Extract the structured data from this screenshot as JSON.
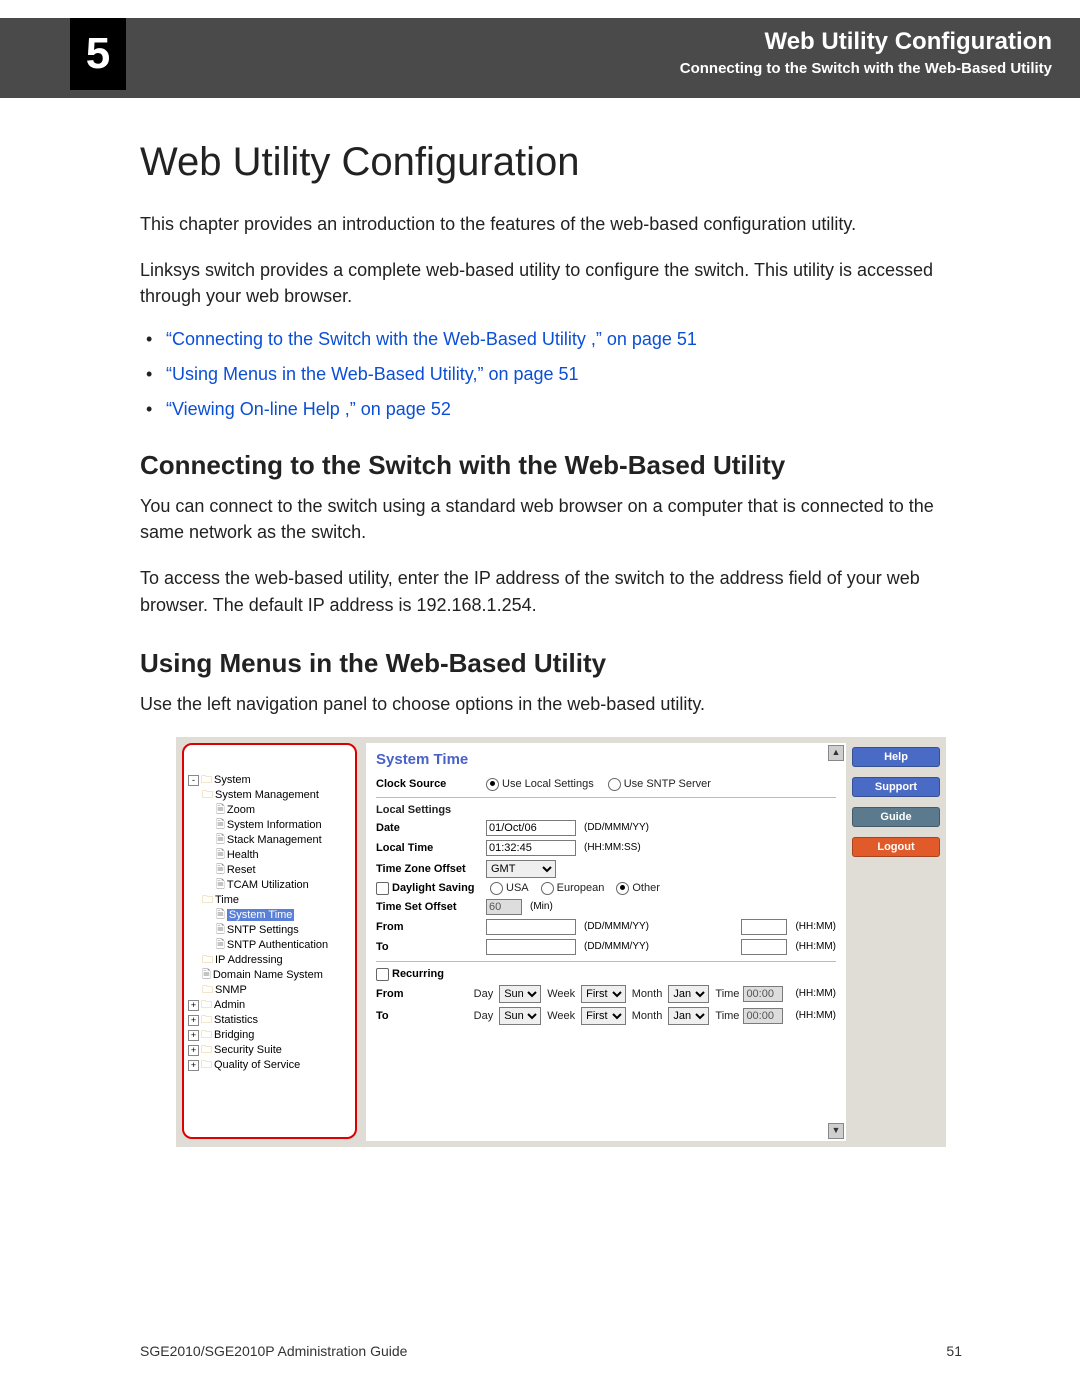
{
  "header": {
    "chapter_number": "5",
    "title": "Web Utility Configuration",
    "subtitle": "Connecting to the Switch with the Web-Based Utility"
  },
  "doc_title": "Web Utility Configuration",
  "intro_p1": "This chapter provides an introduction to the features of the web-based configuration utility.",
  "intro_p2": "Linksys switch provides a complete web-based utility to configure the switch. This utility is accessed through your web browser.",
  "links": [
    "“Connecting to the Switch with the Web-Based Utility ,” on page 51",
    "“Using Menus in the Web-Based Utility,” on page 51",
    "“Viewing On-line Help ,” on page 52"
  ],
  "section1": {
    "heading": "Connecting to the Switch with the Web-Based Utility",
    "p1": "You can connect to the switch using a standard web browser on a computer that is connected to the same network as the switch.",
    "p2": "To access the web-based utility, enter the IP address of the switch to the address field of your web browser. The default IP address is 192.168.1.254."
  },
  "section2": {
    "heading": "Using Menus in the Web-Based Utility",
    "p1": "Use the left navigation panel to choose options in the web-based utility."
  },
  "footer": {
    "left": "SGE2010/SGE2010P Administration Guide",
    "right": "51"
  },
  "screenshot": {
    "panel_title": "System Time",
    "side_buttons": [
      "Help",
      "Support",
      "Guide",
      "Logout"
    ],
    "tree": [
      {
        "depth": 0,
        "exp": "-",
        "icon": "folder",
        "label": "System"
      },
      {
        "depth": 1,
        "exp": "",
        "icon": "folder",
        "label": "System Management"
      },
      {
        "depth": 2,
        "exp": "",
        "icon": "page",
        "label": "Zoom"
      },
      {
        "depth": 2,
        "exp": "",
        "icon": "page",
        "label": "System Information"
      },
      {
        "depth": 2,
        "exp": "",
        "icon": "page",
        "label": "Stack Management"
      },
      {
        "depth": 2,
        "exp": "",
        "icon": "page",
        "label": "Health"
      },
      {
        "depth": 2,
        "exp": "",
        "icon": "page",
        "label": "Reset"
      },
      {
        "depth": 2,
        "exp": "",
        "icon": "page",
        "label": "TCAM Utilization"
      },
      {
        "depth": 1,
        "exp": "",
        "icon": "folder",
        "label": "Time"
      },
      {
        "depth": 2,
        "exp": "",
        "icon": "page",
        "label": "System Time",
        "selected": true
      },
      {
        "depth": 2,
        "exp": "",
        "icon": "page",
        "label": "SNTP Settings"
      },
      {
        "depth": 2,
        "exp": "",
        "icon": "page",
        "label": "SNTP Authentication"
      },
      {
        "depth": 1,
        "exp": "",
        "icon": "folder",
        "label": "IP Addressing"
      },
      {
        "depth": 1,
        "exp": "",
        "icon": "page",
        "label": "Domain Name System"
      },
      {
        "depth": 1,
        "exp": "",
        "icon": "folder",
        "label": "SNMP"
      },
      {
        "depth": 0,
        "exp": "+",
        "icon": "folder",
        "label": "Admin"
      },
      {
        "depth": 0,
        "exp": "+",
        "icon": "folder",
        "label": "Statistics"
      },
      {
        "depth": 0,
        "exp": "+",
        "icon": "folder",
        "label": "Bridging"
      },
      {
        "depth": 0,
        "exp": "+",
        "icon": "folder",
        "label": "Security Suite"
      },
      {
        "depth": 0,
        "exp": "+",
        "icon": "folder",
        "label": "Quality of Service"
      }
    ],
    "form": {
      "clock_source_label": "Clock Source",
      "clock_source_opt1": "Use Local Settings",
      "clock_source_opt2": "Use SNTP Server",
      "local_settings_label": "Local Settings",
      "date_label": "Date",
      "date_value": "01/Oct/06",
      "date_hint": "(DD/MMM/YY)",
      "local_time_label": "Local Time",
      "local_time_value": "01:32:45",
      "local_time_hint": "(HH:MM:SS)",
      "tz_label": "Time Zone Offset",
      "tz_value": "GMT",
      "ds_label": "Daylight Saving",
      "ds_opt1": "USA",
      "ds_opt2": "European",
      "ds_opt3": "Other",
      "tso_label": "Time Set Offset",
      "tso_value": "60",
      "tso_hint": "(Min)",
      "from_label": "From",
      "to_label": "To",
      "range_hint1": "(DD/MMM/YY)",
      "range_hint2": "(HH:MM)",
      "recurring_label": "Recurring",
      "day_lbl": "Day",
      "day_val": "Sun",
      "week_lbl": "Week",
      "week_val": "First",
      "month_lbl": "Month",
      "month_val": "Jan",
      "time_lbl": "Time",
      "time_val": "00:00",
      "time_hint": "(HH:MM)"
    }
  }
}
